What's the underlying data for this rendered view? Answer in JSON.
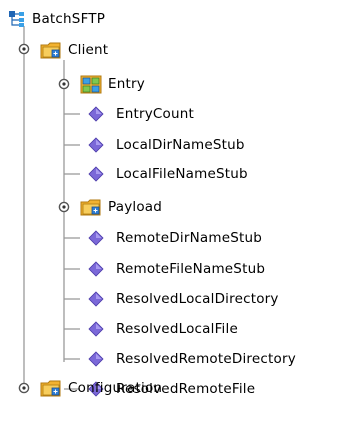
{
  "tree": {
    "root": {
      "label": "BatchSFTP",
      "icon": "tree-structure-icon"
    },
    "client": {
      "label": "Client",
      "icon": "folder-node-icon",
      "expanded": true,
      "entry": {
        "label": "Entry",
        "icon": "group-node-icon",
        "expanded": false
      },
      "fields_a": [
        {
          "label": "EntryCount",
          "icon": "field-diamond-icon"
        },
        {
          "label": "LocalDirNameStub",
          "icon": "field-diamond-icon"
        },
        {
          "label": "LocalFileNameStub",
          "icon": "field-diamond-icon"
        }
      ],
      "payload": {
        "label": "Payload",
        "icon": "folder-node-icon",
        "expanded": false
      },
      "fields_b": [
        {
          "label": "RemoteDirNameStub",
          "icon": "field-diamond-icon"
        },
        {
          "label": "RemoteFileNameStub",
          "icon": "field-diamond-icon"
        },
        {
          "label": "ResolvedLocalDirectory",
          "icon": "field-diamond-icon"
        },
        {
          "label": "ResolvedLocalFile",
          "icon": "field-diamond-icon"
        },
        {
          "label": "ResolvedRemoteDirectory",
          "icon": "field-diamond-icon"
        },
        {
          "label": "ResolvedRemoteFile",
          "icon": "field-diamond-icon"
        }
      ]
    },
    "configuration": {
      "label": "Configuration",
      "icon": "folder-node-icon",
      "expanded": false
    }
  },
  "colors": {
    "tree_line": "#9a9a9a",
    "diamond": "#7b68d8",
    "folder": "#f2b230",
    "root_icon": "#1f66b5"
  }
}
